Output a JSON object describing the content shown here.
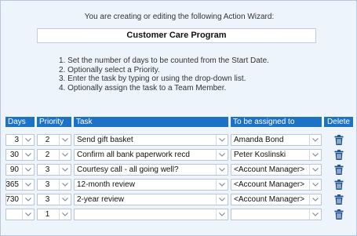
{
  "intro_text": "You are creating or editing the following Action Wizard:",
  "program_name": "Customer Care Program",
  "instructions": [
    "1. Set the number of days to be counted from the Start Date.",
    "2. Optionally select a Priority.",
    "3. Enter the task by typing or using the drop-down list.",
    "4. Optionally assign the task to a Team Member."
  ],
  "columns": {
    "days": "Days",
    "priority": "Priority",
    "task": "Task",
    "assigned": "To be assigned to",
    "delete": "Delete"
  },
  "rows": [
    {
      "days": "3",
      "priority": "2",
      "task": "Send gift basket",
      "assigned": "Amanda Bond"
    },
    {
      "days": "30",
      "priority": "2",
      "task": "Confirm all bank paperwork recd",
      "assigned": "Peter Koslinski"
    },
    {
      "days": "90",
      "priority": "3",
      "task": "Courtesy call - all going well?",
      "assigned": "<Account Manager>"
    },
    {
      "days": "365",
      "priority": "3",
      "task": "12-month review",
      "assigned": "<Account Manager>"
    },
    {
      "days": "730",
      "priority": "3",
      "task": "2-year review",
      "assigned": "<Account Manager>"
    },
    {
      "days": "",
      "priority": "1",
      "task": "",
      "assigned": ""
    }
  ],
  "icons": {
    "dropdown": "chevron-down-icon",
    "delete": "trash-icon"
  },
  "colors": {
    "header": "#1e72c6",
    "panel": "#eef4fb",
    "icon": "#1f4f8f"
  }
}
